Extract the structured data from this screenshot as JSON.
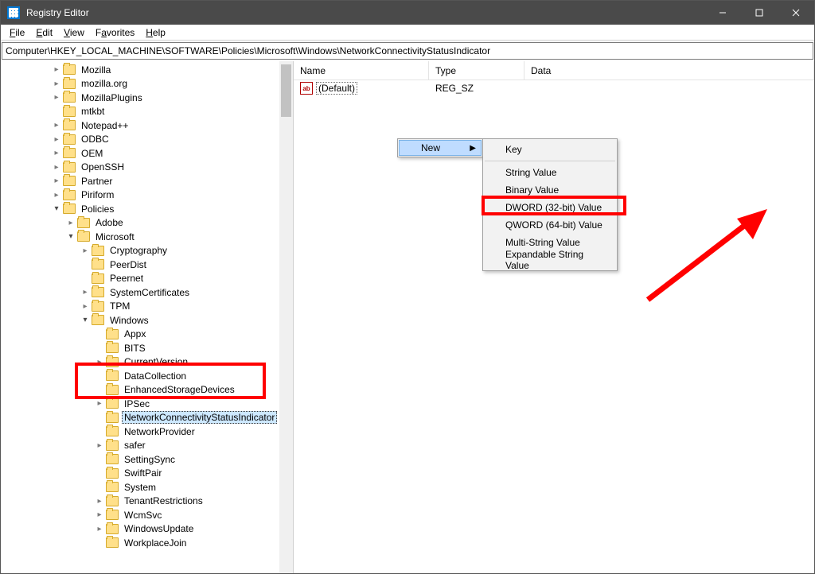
{
  "title": "Registry Editor",
  "menu": {
    "file": "File",
    "edit": "Edit",
    "view": "View",
    "favorites": "Favorites",
    "help": "Help"
  },
  "address": "Computer\\HKEY_LOCAL_MACHINE\\SOFTWARE\\Policies\\Microsoft\\Windows\\NetworkConnectivityStatusIndicator",
  "tree": {
    "top_level": [
      {
        "label": "Mozilla",
        "exp": "closed",
        "depth": 3
      },
      {
        "label": "mozilla.org",
        "exp": "closed",
        "depth": 3
      },
      {
        "label": "MozillaPlugins",
        "exp": "closed",
        "depth": 3
      },
      {
        "label": "mtkbt",
        "exp": "none",
        "depth": 3
      },
      {
        "label": "Notepad++",
        "exp": "closed",
        "depth": 3
      },
      {
        "label": "ODBC",
        "exp": "closed",
        "depth": 3
      },
      {
        "label": "OEM",
        "exp": "closed",
        "depth": 3
      },
      {
        "label": "OpenSSH",
        "exp": "closed",
        "depth": 3
      },
      {
        "label": "Partner",
        "exp": "closed",
        "depth": 3
      },
      {
        "label": "Piriform",
        "exp": "closed",
        "depth": 3
      },
      {
        "label": "Policies",
        "exp": "open",
        "depth": 3
      },
      {
        "label": "Adobe",
        "exp": "closed",
        "depth": 4
      },
      {
        "label": "Microsoft",
        "exp": "open",
        "depth": 4
      },
      {
        "label": "Cryptography",
        "exp": "closed",
        "depth": 5
      },
      {
        "label": "PeerDist",
        "exp": "none",
        "depth": 5
      },
      {
        "label": "Peernet",
        "exp": "none",
        "depth": 5
      },
      {
        "label": "SystemCertificates",
        "exp": "closed",
        "depth": 5
      },
      {
        "label": "TPM",
        "exp": "closed",
        "depth": 5
      },
      {
        "label": "Windows",
        "exp": "open",
        "depth": 5
      },
      {
        "label": "Appx",
        "exp": "none",
        "depth": 6
      },
      {
        "label": "BITS",
        "exp": "none",
        "depth": 6
      },
      {
        "label": "CurrentVersion",
        "exp": "closed",
        "depth": 6
      },
      {
        "label": "DataCollection",
        "exp": "none",
        "depth": 6
      },
      {
        "label": "EnhancedStorageDevices",
        "exp": "none",
        "depth": 6
      },
      {
        "label": "IPSec",
        "exp": "closed",
        "depth": 6
      },
      {
        "label": "NetworkConnectivityStatusIndicator",
        "exp": "none",
        "depth": 6,
        "selected": true
      },
      {
        "label": "NetworkProvider",
        "exp": "none",
        "depth": 6
      },
      {
        "label": "safer",
        "exp": "closed",
        "depth": 6
      },
      {
        "label": "SettingSync",
        "exp": "none",
        "depth": 6
      },
      {
        "label": "SwiftPair",
        "exp": "none",
        "depth": 6
      },
      {
        "label": "System",
        "exp": "none",
        "depth": 6
      },
      {
        "label": "TenantRestrictions",
        "exp": "closed",
        "depth": 6
      },
      {
        "label": "WcmSvc",
        "exp": "closed",
        "depth": 6
      },
      {
        "label": "WindowsUpdate",
        "exp": "closed",
        "depth": 6
      },
      {
        "label": "WorkplaceJoin",
        "exp": "none",
        "depth": 6
      }
    ]
  },
  "list": {
    "columns": {
      "name": "Name",
      "type": "Type",
      "data": "Data"
    },
    "rows": [
      {
        "name": "(Default)",
        "type": "REG_SZ",
        "data": ""
      }
    ]
  },
  "context_menu": {
    "parent_label": "New",
    "items": [
      "Key",
      "String Value",
      "Binary Value",
      "DWORD (32-bit) Value",
      "QWORD (64-bit) Value",
      "Multi-String Value",
      "Expandable String Value"
    ]
  }
}
